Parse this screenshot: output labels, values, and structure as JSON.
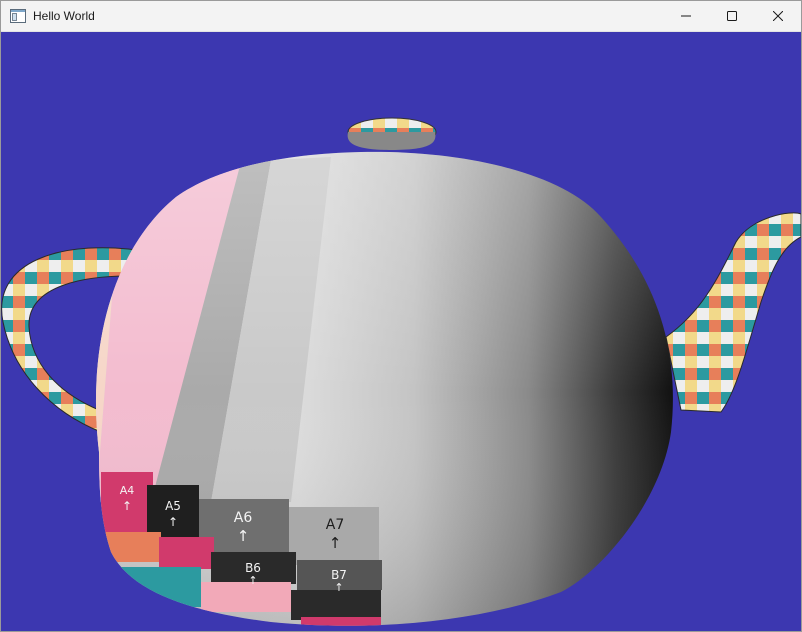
{
  "window": {
    "title": "Hello World",
    "icon": "app-window-icon",
    "controls": {
      "minimize": "minimize-icon",
      "maximize": "maximize-icon",
      "close": "close-icon"
    }
  },
  "scene": {
    "background": "#3c37b0",
    "object": "teapot",
    "texture_tiles": [
      {
        "label": "A4",
        "arrow": "↑"
      },
      {
        "label": "A5",
        "arrow": "↑"
      },
      {
        "label": "A6",
        "arrow": "↑"
      },
      {
        "label": "A7",
        "arrow": "↑"
      },
      {
        "label": "B6",
        "arrow": "↑"
      },
      {
        "label": "B7",
        "arrow": "↑"
      }
    ]
  }
}
